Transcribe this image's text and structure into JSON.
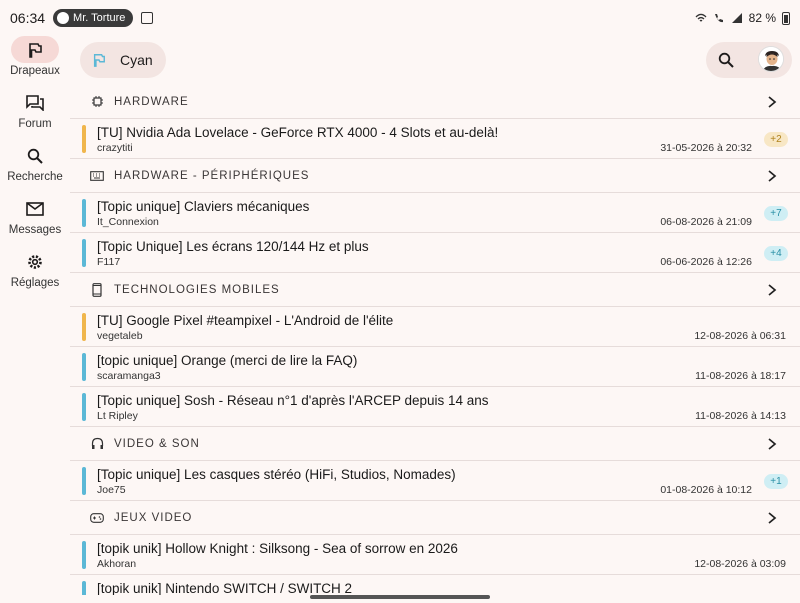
{
  "status_bar": {
    "time": "06:34",
    "media_label": "Mr. Torture",
    "battery": "82 %"
  },
  "nav": [
    {
      "label": "Drapeaux",
      "icon": "flag-icon",
      "active": true
    },
    {
      "label": "Forum",
      "icon": "forum-icon",
      "active": false
    },
    {
      "label": "Recherche",
      "icon": "search-icon",
      "active": false
    },
    {
      "label": "Messages",
      "icon": "mail-icon",
      "active": false
    },
    {
      "label": "Réglages",
      "icon": "gear-icon",
      "active": false
    }
  ],
  "topbar": {
    "flag_filter": "Cyan"
  },
  "colors": {
    "orange": "#f0b64c",
    "blue": "#5bb8d6",
    "accent_chip": "#f3e5e2",
    "active_nav": "#f6d9d6"
  },
  "categories": [
    {
      "name": "HARDWARE",
      "icon": "chip-icon",
      "topics": [
        {
          "title": "[TU] Nvidia Ada Lovelace - GeForce RTX 4000 - 4 Slots et au-delà!",
          "author": "crazytiti",
          "date": "31-05-2026 à 20:32",
          "badge": "+2",
          "color": "orange"
        }
      ]
    },
    {
      "name": "HARDWARE - PÉRIPHÉRIQUES",
      "icon": "keyboard-icon",
      "topics": [
        {
          "title": "[Topic unique] Claviers mécaniques",
          "author": "It_Connexion",
          "date": "06-08-2026 à 21:09",
          "badge": "+7",
          "color": "blue"
        },
        {
          "title": "[Topic Unique] Les écrans 120/144 Hz et plus",
          "author": "F117",
          "date": "06-06-2026 à 12:26",
          "badge": "+4",
          "color": "blue"
        }
      ]
    },
    {
      "name": "TECHNOLOGIES MOBILES",
      "icon": "phone-icon",
      "topics": [
        {
          "title": "[TU] Google Pixel #teampixel - L'Android de l'élite",
          "author": "vegetaleb",
          "date": "12-08-2026 à 06:31",
          "badge": "",
          "color": "orange"
        },
        {
          "title": "[topic unique] Orange (merci de lire la FAQ)",
          "author": "scaramanga3",
          "date": "11-08-2026 à 18:17",
          "badge": "",
          "color": "blue"
        },
        {
          "title": "[Topic unique] Sosh - Réseau n°1 d'après l'ARCEP depuis 14 ans",
          "author": "Lt Ripley",
          "date": "11-08-2026 à 14:13",
          "badge": "",
          "color": "blue"
        }
      ]
    },
    {
      "name": "VIDEO & SON",
      "icon": "headphones-icon",
      "topics": [
        {
          "title": "[Topic unique] Les casques stéréo (HiFi, Studios, Nomades)",
          "author": "Joe75",
          "date": "01-08-2026 à 10:12",
          "badge": "+1",
          "color": "blue"
        }
      ]
    },
    {
      "name": "JEUX VIDEO",
      "icon": "gamepad-icon",
      "topics": [
        {
          "title": "[topik unik] Hollow Knight : Silksong - Sea of sorrow en 2026",
          "author": "Akhoran",
          "date": "12-08-2026 à 03:09",
          "badge": "",
          "color": "blue"
        },
        {
          "title": "[topik unik] Nintendo SWITCH / SWITCH 2",
          "author": "",
          "date": "",
          "badge": "",
          "color": "blue"
        }
      ]
    }
  ]
}
